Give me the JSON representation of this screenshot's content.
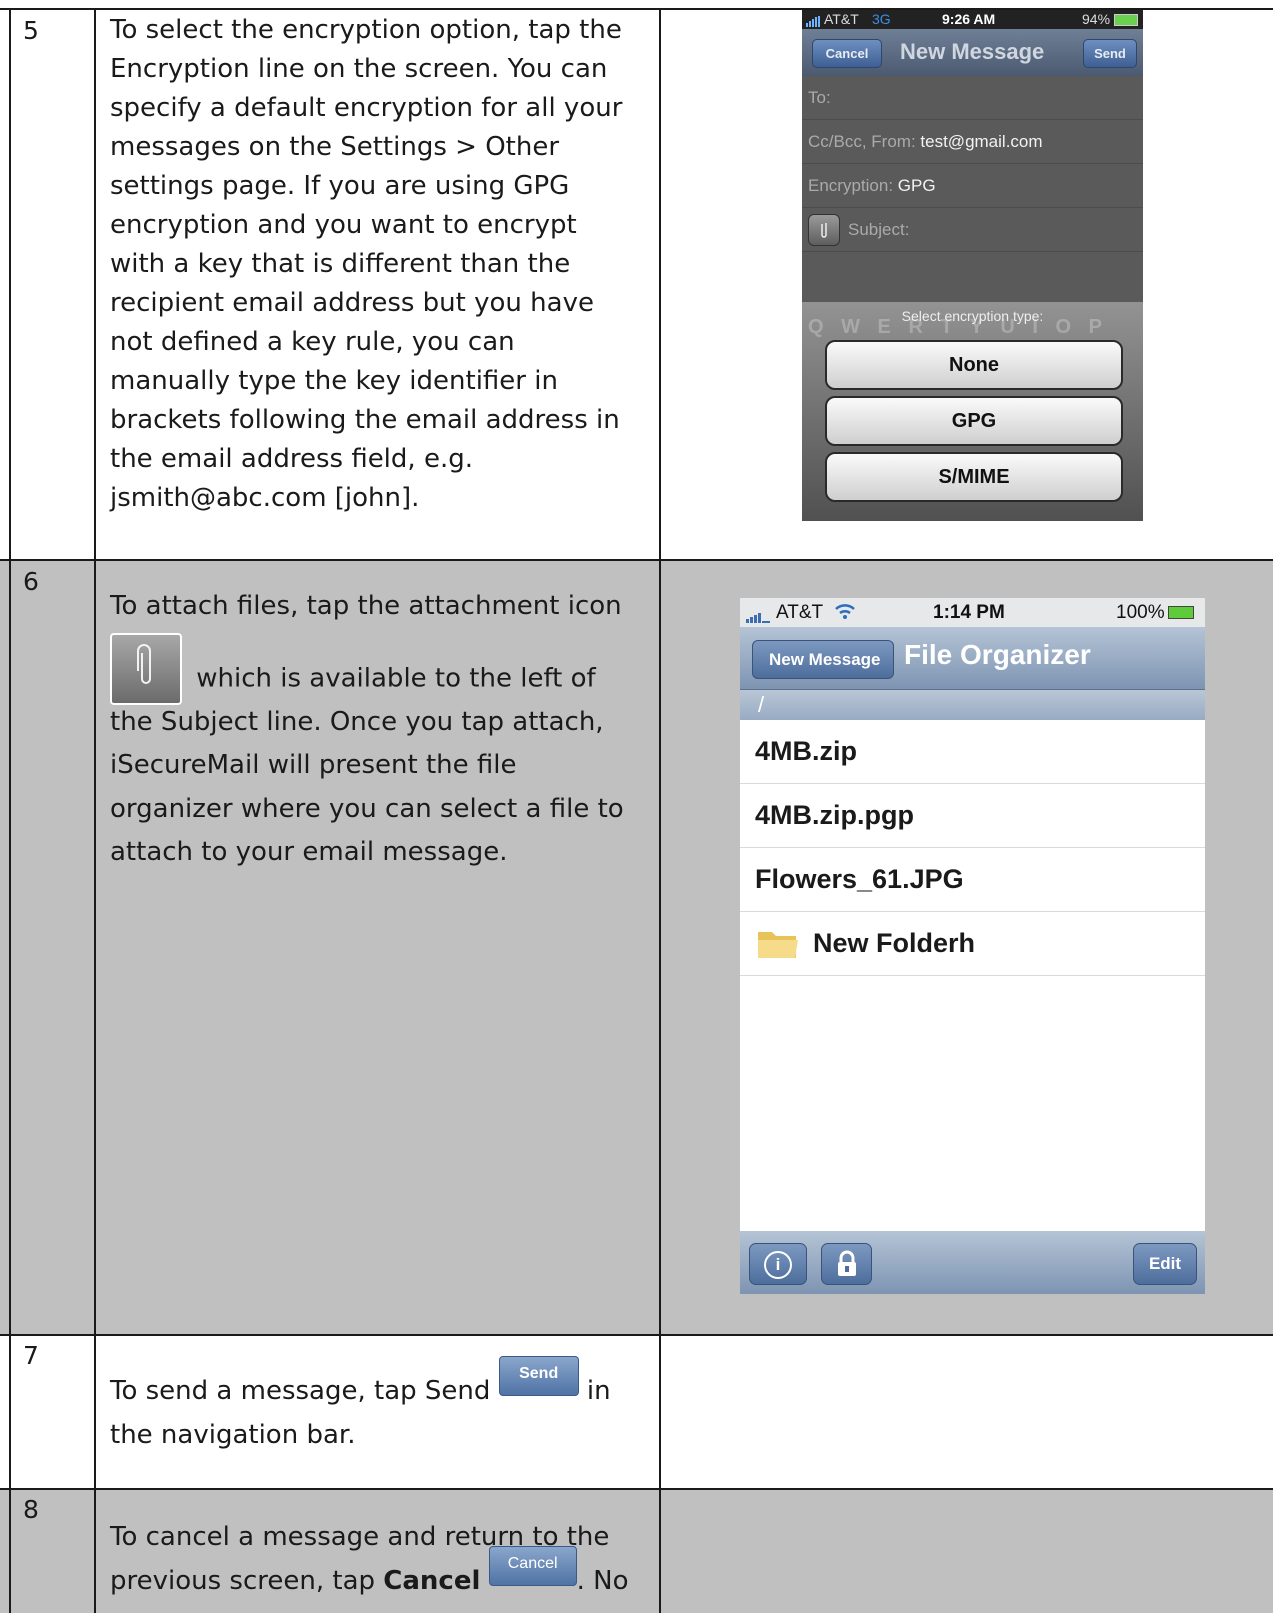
{
  "rows": [
    {
      "number": "5",
      "text": "To select the encryption option, tap the Encryption line on the screen.  You can specify a default encryption for all your messages on the Settings > Other settings page.  If you are using GPG encryption and you want to encrypt with a key that is different than the recipient email address but you have not defined a key rule, you can manually type the key identifier in brackets following the email address in the email address field, e.g. jsmith@abc.com [john]."
    },
    {
      "number": "6",
      "text_before_icon": "To attach files, tap the attachment icon",
      "text_after_icon": "which is available to the left of the Subject line. Once you tap attach, iSecureMail will present the file organizer where you can select a file to attach to your email message."
    },
    {
      "number": "7",
      "text_before_button": "To send a message, tap Send",
      "inline_button": "Send",
      "text_after_button": "in the navigation bar."
    },
    {
      "number": "8",
      "text_before_bold": "To cancel a message and return to the previous screen, tap",
      "bold_word": "Cancel",
      "inline_button": "Cancel",
      "text_after_button": ". No"
    }
  ],
  "phone1": {
    "status": {
      "carrier": "AT&T",
      "network": "3G",
      "time": "9:26 AM",
      "battery": "94%"
    },
    "nav": {
      "cancel": "Cancel",
      "title": "New Message",
      "send": "Send"
    },
    "fields": {
      "to_label": "To:",
      "ccbcc_label": "Cc/Bcc, From:",
      "ccbcc_value": "test@gmail.com",
      "encryption_label": "Encryption:",
      "encryption_value": "GPG",
      "subject_label": "Subject:"
    },
    "sheet": {
      "title": "Select encryption type:",
      "options": [
        "None",
        "GPG",
        "S/MIME"
      ]
    },
    "keyboard_hint": "Q W E R T Y U I O P"
  },
  "phone2": {
    "status": {
      "carrier": "AT&T",
      "time": "1:14 PM",
      "battery": "100%"
    },
    "nav": {
      "back": "New Message",
      "title": "File Organizer"
    },
    "path": "/",
    "files": [
      {
        "name": "4MB.zip",
        "icon": "none"
      },
      {
        "name": "4MB.zip.pgp",
        "icon": "none"
      },
      {
        "name": "Flowers_61.JPG",
        "icon": "none"
      },
      {
        "name": "New Folderh",
        "icon": "folder-icon"
      }
    ],
    "toolbar": {
      "edit": "Edit"
    }
  }
}
